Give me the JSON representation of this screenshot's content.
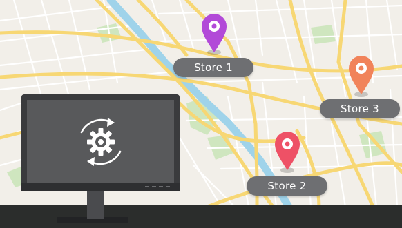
{
  "colors": {
    "map_background": "#f2efe9",
    "major_road": "#f7d774",
    "minor_road": "#ffffff",
    "river": "#9fd3ea",
    "park": "#cfe6bf",
    "floor_bar": "#2b2d2c",
    "monitor_frame": "#3a3b3d",
    "monitor_screen": "#58595b",
    "label_background": "#6e6f72"
  },
  "map": {
    "stores": [
      {
        "label": "Store 1",
        "pin_color": "#b24ad8",
        "icon": "map-pin-icon"
      },
      {
        "label": "Store 2",
        "pin_color": "#ee5166",
        "icon": "map-pin-icon"
      },
      {
        "label": "Store 3",
        "pin_color": "#f1835a",
        "icon": "map-pin-icon"
      }
    ]
  },
  "monitor": {
    "screen_icon": "gear-sync-icon"
  }
}
